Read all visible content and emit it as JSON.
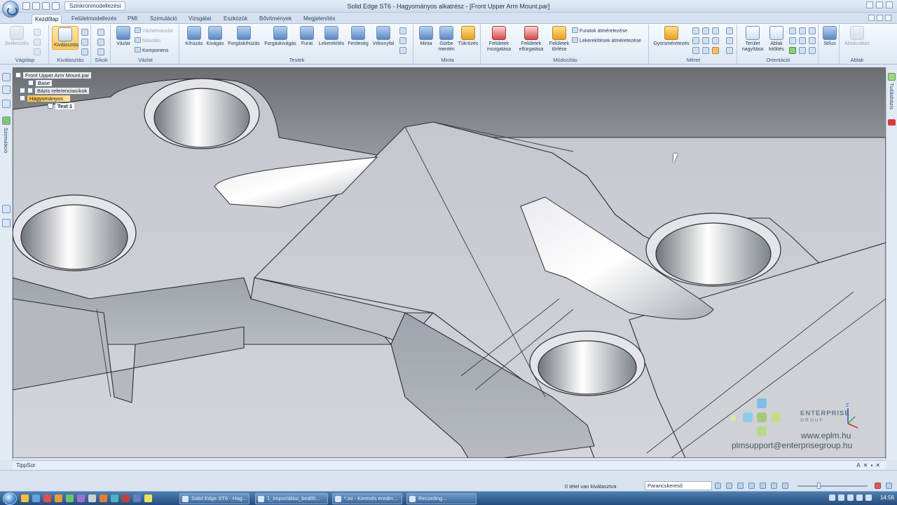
{
  "window": {
    "title": "Solid Edge ST6 - Hagyományos alkatrész - [Front Upper Arm Mount.par]",
    "environment": "Szinkronmodellezési"
  },
  "tabs": [
    {
      "label": "Kezdőlap",
      "active": true
    },
    {
      "label": "Felületmodellezés"
    },
    {
      "label": "PMI"
    },
    {
      "label": "Szimuláció"
    },
    {
      "label": "Vizsgálat"
    },
    {
      "label": "Eszközök"
    },
    {
      "label": "Bővítmények"
    },
    {
      "label": "Megjelenítés"
    }
  ],
  "ribbon": {
    "groups": {
      "vagolap": "Vágólap",
      "kivalasztas": "Kiválasztás",
      "sikok": "Síkok",
      "vazlat": "Vázlat",
      "testek": "Testek",
      "minta": "Minta",
      "modositas": "Módosítás",
      "meret": "Méret",
      "orientacio": "Orientáció",
      "ablak": "Ablak"
    },
    "commands": {
      "beillesztes": "Beillesztés",
      "kivalasztas": "Kiválasztás",
      "vazlat": "Vázlat",
      "vazlatmasolat": "Vázlatmásolat",
      "masolas": "Másolás",
      "komponens": "Komponens",
      "kihuzas": "Kihúzás",
      "kivagas": "Kivágás",
      "forgaskihuzas": "Forgáskihúzás",
      "forgaskivagas": "Forgáskivágás",
      "furat": "Furat",
      "lekerekites": "Lekerekítés",
      "ferdeseg": "Ferdeség",
      "vekonyfal": "Vékonyfal",
      "minta": "Minta",
      "gorbe_menten": "Görbe mentén",
      "tukrozes": "Tükrözés",
      "feluletek_mozgatasa": "Felületek mozgatása",
      "feluletek_elforgatasa": "Felületek elforgatása",
      "feluletek_torlese": "Felületek törlése",
      "furatok_atmeretezese": "Furatok átméretezése",
      "lekerekitesek_atmeretezese": "Lekerekítések átméretezése",
      "gyorsmeretezes": "Gyorsméretezés",
      "terulet_nagyitasa": "Terület nagyítása",
      "ablak_kitoltes": "Ablak kitöltés",
      "stilus": "Stílus",
      "ablakvaltas": "Ablakváltás"
    }
  },
  "sidebar": {
    "left_label": "Szimuláció",
    "right_label": "Tudásbázis"
  },
  "tree": {
    "root": "Front Upper Arm Mount.par",
    "items": [
      "Base",
      "Bázis referenciasíkok",
      "Hagyományos",
      "Test 1"
    ]
  },
  "branding": {
    "company": "ENTERPRISE",
    "sub": "GROUP",
    "url": "www.eplm.hu",
    "email": "plmsupport@enterprisegroup.hu"
  },
  "prompt_bar": {
    "label": "TippSor"
  },
  "status": {
    "selection": "0 tétel van kiválasztva",
    "command_finder": "Parancskereső"
  },
  "taskbar": {
    "buttons": [
      "Solid Edge ST6 - Hag...",
      "1_Importálási_beállít...",
      "*.ini - Keresés eredm...",
      "Recording..."
    ],
    "clock": "14:56"
  },
  "colors": {
    "selection_highlight": "#f8c04a",
    "ribbon_accent": "#5a88c2",
    "model_surface": "#c9ccd3"
  }
}
